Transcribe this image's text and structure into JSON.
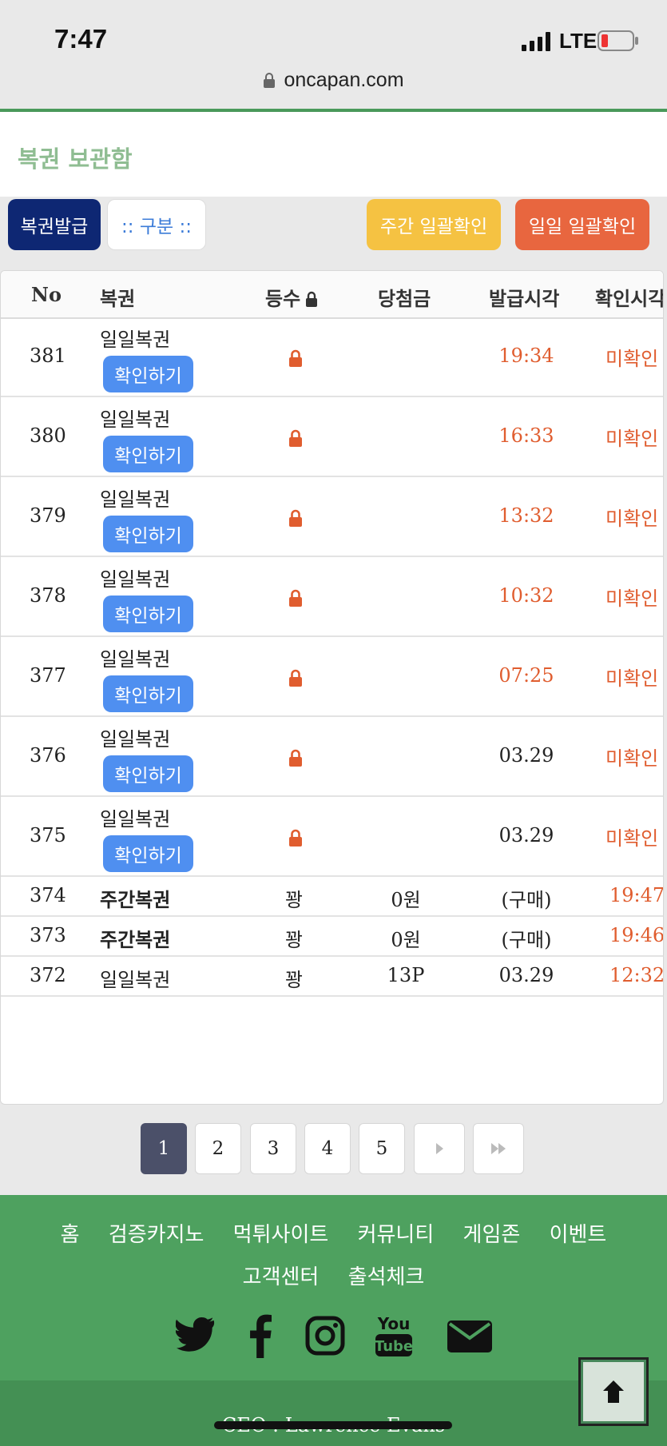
{
  "status_bar": {
    "time": "7:47",
    "network": "LTE"
  },
  "browser": {
    "url": "oncapan.com"
  },
  "page": {
    "title": "복권 보관함"
  },
  "actions": {
    "issue_label": "복권발급",
    "filter_label": ":: 구분 ::",
    "weekly_check_label": "주간 일괄확인",
    "daily_check_label": "일일 일괄확인"
  },
  "table": {
    "headers": {
      "no": "No",
      "name": "복권",
      "rank": "등수",
      "prize": "당첨금",
      "issued": "발급시각",
      "checked": "확인시각"
    },
    "confirm_label": "확인하기",
    "rows": [
      {
        "no": "381",
        "name": "일일복권",
        "issued": "19:34",
        "checked": "미확인"
      },
      {
        "no": "380",
        "name": "일일복권",
        "issued": "16:33",
        "checked": "미확인"
      },
      {
        "no": "379",
        "name": "일일복권",
        "issued": "13:32",
        "checked": "미확인"
      },
      {
        "no": "378",
        "name": "일일복권",
        "issued": "10:32",
        "checked": "미확인"
      },
      {
        "no": "377",
        "name": "일일복권",
        "issued": "07:25",
        "checked": "미확인"
      },
      {
        "no": "376",
        "name": "일일복권",
        "issued": "03.29",
        "checked": "미확인"
      },
      {
        "no": "375",
        "name": "일일복권",
        "issued": "03.29",
        "checked": "미확인"
      },
      {
        "no": "374",
        "name": "주간복권",
        "rank": "꽝",
        "prize": "0원",
        "issued": "(구매)",
        "checked": "19:47"
      },
      {
        "no": "373",
        "name": "주간복권",
        "rank": "꽝",
        "prize": "0원",
        "issued": "(구매)",
        "checked": "19:46"
      },
      {
        "no": "372",
        "name": "일일복권",
        "rank": "꽝",
        "prize": "13P",
        "issued": "03.29",
        "checked": "12:32"
      }
    ]
  },
  "pagination": {
    "pages": [
      "1",
      "2",
      "3",
      "4",
      "5"
    ],
    "current": "1"
  },
  "footer": {
    "nav": [
      "홈",
      "검증카지노",
      "먹튀사이트",
      "커뮤니티",
      "게임존",
      "이벤트",
      "고객센터",
      "출석체크"
    ],
    "social_icons": [
      "twitter-icon",
      "facebook-icon",
      "instagram-icon",
      "youtube-icon",
      "mail-icon"
    ],
    "ceo": "CEO : Lawrence Evans"
  },
  "colors": {
    "issue_button": "#0e2773",
    "weekly_button": "#f5c242",
    "daily_button": "#e8663f",
    "confirm_button": "#4f8ff0",
    "accent_orange": "#e05d2f",
    "footer_green": "#4ea15f",
    "active_page": "#4b5069"
  }
}
